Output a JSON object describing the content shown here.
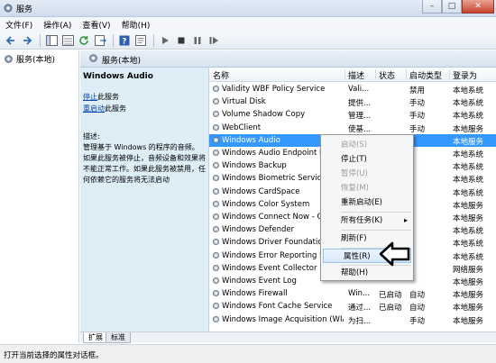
{
  "window": {
    "title": "服务",
    "controls": {
      "minimize": "–",
      "maximize": "□",
      "close": "✕"
    }
  },
  "menu": [
    "文件(F)",
    "操作(A)",
    "查看(V)",
    "帮助(H)"
  ],
  "tree": {
    "root_label": "服务(本地)"
  },
  "header_tab": {
    "label": "服务(本地)"
  },
  "description_pane": {
    "service_title": "Windows Audio",
    "stop_link": "停止",
    "stop_suffix": "此服务",
    "restart_link": "重启动",
    "restart_suffix": "此服务",
    "desc_label": "描述:",
    "desc_text": "管理基于 Windows 的程序的音频。如果此服务被停止，音频设备和效果将不能正常工作。如果此服务被禁用，任何依赖它的服务将无法启动"
  },
  "columns": [
    "名称",
    "描述",
    "状态",
    "启动类型",
    "登录为"
  ],
  "services": [
    {
      "name": "Validity WBF Policy Service",
      "desc": "Vali...",
      "status": "",
      "start": "禁用",
      "login": "本地系统"
    },
    {
      "name": "Virtual Disk",
      "desc": "提供...",
      "status": "",
      "start": "手动",
      "login": "本地系统"
    },
    {
      "name": "Volume Shadow Copy",
      "desc": "管理...",
      "status": "",
      "start": "手动",
      "login": "本地系统"
    },
    {
      "name": "WebClient",
      "desc": "使基...",
      "status": "",
      "start": "手动",
      "login": "本地服务"
    },
    {
      "name": "Windows Audio",
      "desc": "",
      "status": "",
      "start": "",
      "login": "本地服务"
    },
    {
      "name": "Windows Audio Endpoint B",
      "desc": "",
      "status": "",
      "start": "",
      "login": "本地系统"
    },
    {
      "name": "Windows Backup",
      "desc": "",
      "status": "",
      "start": "",
      "login": "本地系统"
    },
    {
      "name": "Windows Biometric Service",
      "desc": "",
      "status": "",
      "start": "",
      "login": "本地系统"
    },
    {
      "name": "Windows CardSpace",
      "desc": "",
      "status": "",
      "start": "",
      "login": "本地系统"
    },
    {
      "name": "Windows Color System",
      "desc": "",
      "status": "",
      "start": "",
      "login": "本地服务"
    },
    {
      "name": "Windows Connect Now - Co",
      "desc": "",
      "status": "",
      "start": "",
      "login": "本地服务"
    },
    {
      "name": "Windows Defender",
      "desc": "",
      "status": "",
      "start": "",
      "login": "本地系统"
    },
    {
      "name": "Windows Driver Foundation",
      "desc": "",
      "status": "",
      "start": "",
      "login": "本地系统"
    },
    {
      "name": "Windows Error Reporting S",
      "desc": "",
      "status": "",
      "start": "",
      "login": "本地系统"
    },
    {
      "name": "Windows Event Collector",
      "desc": "",
      "status": "",
      "start": "",
      "login": "网络服务"
    },
    {
      "name": "Windows Event Log",
      "desc": "",
      "status": "",
      "start": "",
      "login": "本地服务"
    },
    {
      "name": "Windows Firewall",
      "desc": "Win...",
      "status": "已启动",
      "start": "自动",
      "login": "本地服务"
    },
    {
      "name": "Windows Font Cache Service",
      "desc": "通过...",
      "status": "已启动",
      "start": "自动",
      "login": "本地服务"
    },
    {
      "name": "Windows Image Acquisition (WIA)",
      "desc": "为扫...",
      "status": "",
      "start": "手动",
      "login": "本地服务"
    }
  ],
  "context_menu": {
    "start": "启动(S)",
    "stop": "停止(T)",
    "pause": "暂停(U)",
    "resume": "恢复(M)",
    "restart": "重新启动(E)",
    "all_tasks": "所有任务(K)",
    "refresh": "刷新(F)",
    "properties": "属性(R)",
    "help": "帮助(H)"
  },
  "bottom_tabs": [
    "扩展",
    "标准"
  ],
  "status_text": "打开当前选择的属性对话框。",
  "colors": {
    "selection": "#3399ff",
    "desc_pane_bg": "#ddeef7",
    "link": "#0645ad"
  }
}
